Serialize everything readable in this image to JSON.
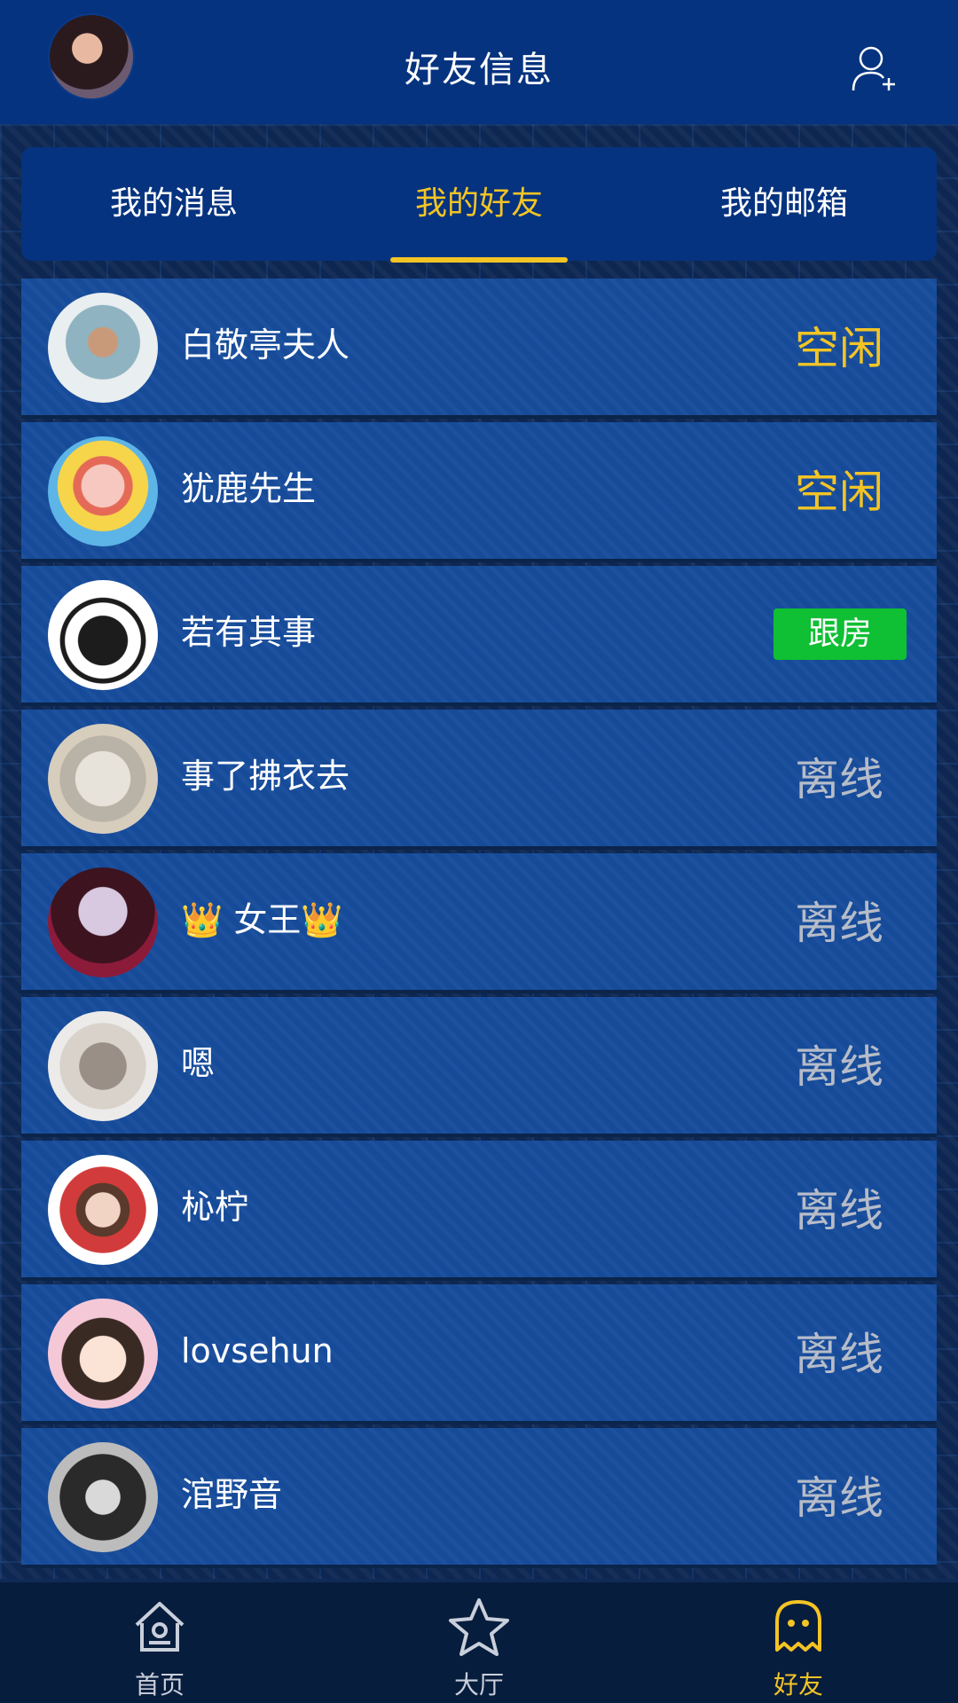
{
  "header": {
    "title": "好友信息",
    "avatar_icon": "user-avatar",
    "add_icon": "add-friend-icon"
  },
  "tabs": [
    {
      "label": "我的消息",
      "active": false
    },
    {
      "label": "我的好友",
      "active": true
    },
    {
      "label": "我的邮箱",
      "active": false
    }
  ],
  "friends": [
    {
      "name": "白敬亭夫人",
      "status": "空闲",
      "status_type": "idle"
    },
    {
      "name": "犹鹿先生",
      "status": "空闲",
      "status_type": "idle"
    },
    {
      "name": "若有其事",
      "status": "跟房",
      "status_type": "follow"
    },
    {
      "name": "事了拂衣去",
      "status": "离线",
      "status_type": "offline"
    },
    {
      "name": "👑 女王👑",
      "status": "离线",
      "status_type": "offline"
    },
    {
      "name": "嗯",
      "status": "离线",
      "status_type": "offline"
    },
    {
      "name": "杺柠",
      "status": "离线",
      "status_type": "offline"
    },
    {
      "name": "lovsehun",
      "status": "离线",
      "status_type": "offline"
    },
    {
      "name": "涫野音",
      "status": "离线",
      "status_type": "offline"
    }
  ],
  "nav": [
    {
      "label": "首页",
      "icon": "home-icon",
      "active": false
    },
    {
      "label": "大厅",
      "icon": "star-icon",
      "active": false
    },
    {
      "label": "好友",
      "icon": "ghost-icon",
      "active": true
    }
  ],
  "colors": {
    "accent": "#f3c424",
    "header_bg": "#06337f",
    "row_bg": "#164b9a",
    "follow_green": "#0fbf34",
    "offline_gray": "#b6bcc8"
  }
}
